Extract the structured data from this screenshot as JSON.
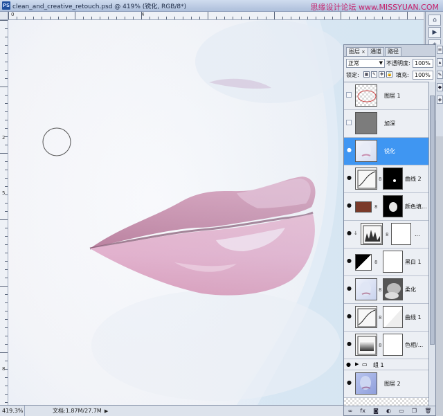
{
  "window": {
    "app_badge": "PS",
    "title": "clean_and_creative_retouch.psd @ 419% (锐化, RGB/8*)",
    "watermark": "思缘设计论坛 www.MISSYUAN.COM"
  },
  "rulers": {
    "top_labels": [
      "0",
      "4"
    ],
    "left_labels": [
      "2",
      "5",
      "8"
    ]
  },
  "status": {
    "zoom": "419.3%",
    "doc_size": "文档:1.87M/27.7M"
  },
  "layers_panel": {
    "tabs": [
      {
        "label": "图层",
        "active": true
      },
      {
        "label": "通道",
        "active": false
      },
      {
        "label": "路径",
        "active": false
      }
    ],
    "blend_mode": "正常",
    "opacity_label": "不透明度:",
    "opacity_value": "100%",
    "lock_label": "锁定:",
    "fill_label": "填充:",
    "fill_value": "100%",
    "layers": [
      {
        "name": "图层 1",
        "visible": false,
        "thumb": "checker-red",
        "mask": null,
        "selected": false
      },
      {
        "name": "加深",
        "visible": false,
        "thumb": "gray",
        "mask": null,
        "selected": false
      },
      {
        "name": "锐化",
        "visible": true,
        "thumb": "portrait",
        "mask": null,
        "selected": true
      },
      {
        "name": "曲线 2",
        "visible": true,
        "thumb": "curves",
        "mask": "black-dot",
        "selected": false
      },
      {
        "name": "颜色填...",
        "visible": true,
        "thumb": "brown",
        "mask": "black-blob",
        "selected": false
      },
      {
        "name": "...",
        "visible": true,
        "thumb": "levels",
        "mask": "white",
        "selected": false
      },
      {
        "name": "黑白 1",
        "visible": true,
        "thumb": "bw",
        "mask": "white",
        "selected": false
      },
      {
        "name": "柔化",
        "visible": true,
        "thumb": "portrait",
        "mask": "blur-mask",
        "selected": false
      },
      {
        "name": "曲线 1",
        "visible": true,
        "thumb": "curves",
        "mask": "white",
        "selected": false
      },
      {
        "name": "色相/...",
        "visible": true,
        "thumb": "hue",
        "mask": "white",
        "selected": false
      }
    ],
    "group": {
      "name": "组 1",
      "visible": true
    },
    "bottom_layer": {
      "name": "图层 2",
      "visible": true
    },
    "footer_icons": [
      "link-icon",
      "fx-icon",
      "mask-icon",
      "adjustment-icon",
      "folder-icon",
      "new-layer-icon",
      "trash-icon"
    ]
  },
  "colors": {
    "selection": "#3f96f2",
    "lip": "#d99ab6",
    "skin": "#f3f4f8"
  }
}
